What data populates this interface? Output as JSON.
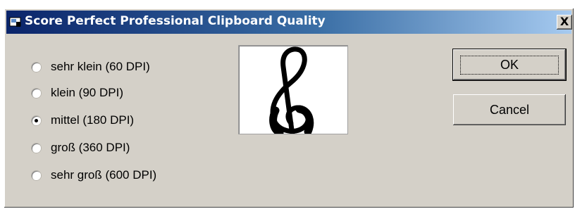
{
  "window": {
    "title": "Score Perfect Professional Clipboard Quality",
    "close_label": "X"
  },
  "options": [
    {
      "label": "sehr klein (60 DPI)",
      "checked": false
    },
    {
      "label": "klein (90 DPI)",
      "checked": false
    },
    {
      "label": "mittel (180 DPI)",
      "checked": true
    },
    {
      "label": "groß (360 DPI)",
      "checked": false
    },
    {
      "label": "sehr groß (600 DPI)",
      "checked": false
    }
  ],
  "preview": {
    "icon": "treble-clef-icon"
  },
  "buttons": {
    "ok": "OK",
    "cancel": "Cancel"
  }
}
